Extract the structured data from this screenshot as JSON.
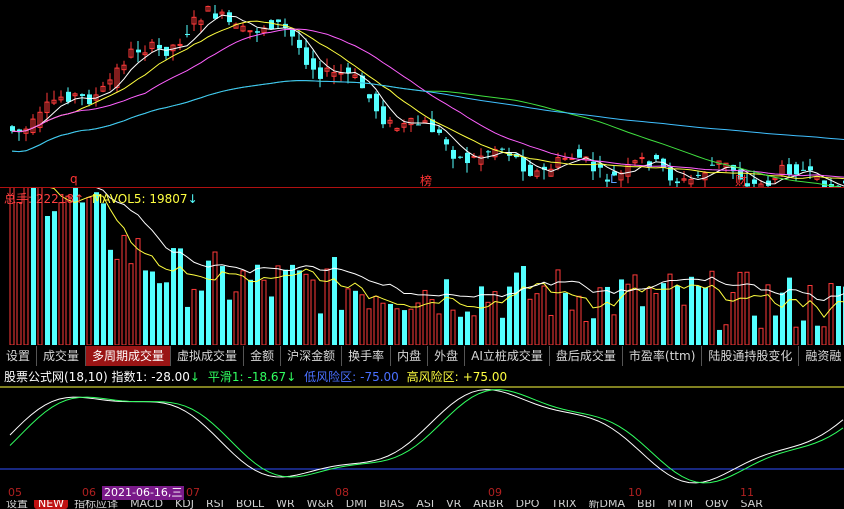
{
  "volume_header": {
    "total_label": "总手:",
    "total_value": "22218",
    "total_arrow": "↑",
    "mavol_label": "MAVOL5:",
    "mavol_value": "19807",
    "mavol_arrow": "↓"
  },
  "price_markers": [
    {
      "text": "q",
      "color": "#ff3333"
    },
    {
      "text": "榜",
      "color": "#ff3333"
    },
    {
      "text": "L",
      "color": "#5aa0ff"
    },
    {
      "text": "财",
      "color": "#ff3333"
    }
  ],
  "tabs": [
    {
      "label": "设置",
      "active": false
    },
    {
      "label": "成交量",
      "active": false
    },
    {
      "label": "多周期成交量",
      "active": true
    },
    {
      "label": "虚拟成交量",
      "active": false
    },
    {
      "label": "金额",
      "active": false
    },
    {
      "label": "沪深金额",
      "active": false
    },
    {
      "label": "换手率",
      "active": false
    },
    {
      "label": "内盘",
      "active": false
    },
    {
      "label": "外盘",
      "active": false
    },
    {
      "label": "AI立桩成交量",
      "active": false
    },
    {
      "label": "盘后成交量",
      "active": false
    },
    {
      "label": "市盈率(ttm)",
      "active": false
    },
    {
      "label": "陆股通持股变化",
      "active": false
    },
    {
      "label": "融资融",
      "active": false
    }
  ],
  "indicator_header": {
    "name": "股票公式网(18,10)",
    "index_label": "指数1:",
    "index_value": "-28.00",
    "index_arrow": "↓",
    "smooth_label": "平滑1:",
    "smooth_value": "-18.67",
    "smooth_arrow": "↓",
    "low_label": "低风险区:",
    "low_value": "-75.00",
    "high_label": "高风险区:",
    "high_value": "+75.00"
  },
  "date_axis": {
    "months": [
      "05",
      "06",
      "07",
      "08",
      "09",
      "10",
      "11"
    ],
    "selected_date": "2021-06-16,三"
  },
  "bottom_tabs": [
    "设置",
    "NEW",
    "指标应译",
    "MACD",
    "KDJ",
    "RSI",
    "BOLL",
    "WR",
    "W&R",
    "DMI",
    "BIAS",
    "ASI",
    "VR",
    "ARBR",
    "DPO",
    "TRIX",
    "新DMA",
    "BBI",
    "MTM",
    "OBV",
    "SAR"
  ],
  "colors": {
    "up": "#ff3a3a",
    "down": "#54ffff",
    "ma5": "#ffffff",
    "ma10": "#ffff40",
    "ma20": "#ff60ff",
    "ma60": "#40e040",
    "ma120": "#40c0ff",
    "low_line": "#3050ff",
    "high_line": "#ffff40",
    "index_line": "#ffffff",
    "smooth_line": "#30ff60"
  }
}
